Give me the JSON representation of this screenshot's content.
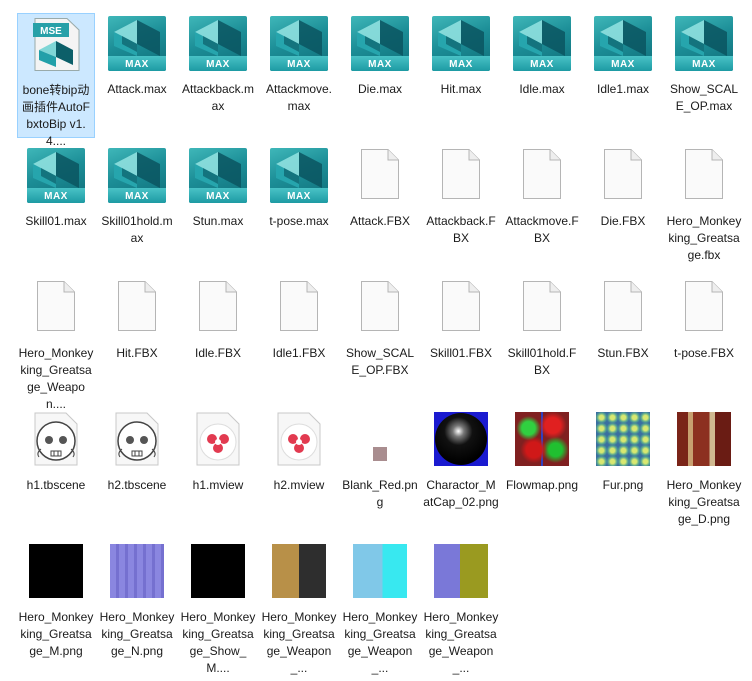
{
  "files": [
    {
      "name": "bone转bip动画插件AutoFbxtoBip v1.4....",
      "icon": "mse-icon",
      "selected": true
    },
    {
      "name": "Attack.max",
      "icon": "max-icon"
    },
    {
      "name": "Attackback.max",
      "icon": "max-icon"
    },
    {
      "name": "Attackmove.max",
      "icon": "max-icon"
    },
    {
      "name": "Die.max",
      "icon": "max-icon"
    },
    {
      "name": "Hit.max",
      "icon": "max-icon"
    },
    {
      "name": "Idle.max",
      "icon": "max-icon"
    },
    {
      "name": "Idle1.max",
      "icon": "max-icon"
    },
    {
      "name": "Show_SCALE_OP.max",
      "icon": "max-icon"
    },
    {
      "name": "Skill01.max",
      "icon": "max-icon"
    },
    {
      "name": "Skill01hold.max",
      "icon": "max-icon"
    },
    {
      "name": "Stun.max",
      "icon": "max-icon"
    },
    {
      "name": "t-pose.max",
      "icon": "max-icon"
    },
    {
      "name": "Attack.FBX",
      "icon": "file-icon"
    },
    {
      "name": "Attackback.FBX",
      "icon": "file-icon"
    },
    {
      "name": "Attackmove.FBX",
      "icon": "file-icon"
    },
    {
      "name": "Die.FBX",
      "icon": "file-icon"
    },
    {
      "name": "Hero_Monkeyking_Greatsage.fbx",
      "icon": "file-icon"
    },
    {
      "name": "Hero_Monkeyking_Greatsage_Weapon....",
      "icon": "file-icon"
    },
    {
      "name": "Hit.FBX",
      "icon": "file-icon"
    },
    {
      "name": "Idle.FBX",
      "icon": "file-icon"
    },
    {
      "name": "Idle1.FBX",
      "icon": "file-icon"
    },
    {
      "name": "Show_SCALE_OP.FBX",
      "icon": "file-icon"
    },
    {
      "name": "Skill01.FBX",
      "icon": "file-icon"
    },
    {
      "name": "Skill01hold.FBX",
      "icon": "file-icon"
    },
    {
      "name": "Stun.FBX",
      "icon": "file-icon"
    },
    {
      "name": "t-pose.FBX",
      "icon": "file-icon"
    },
    {
      "name": "h1.tbscene",
      "icon": "skull-icon"
    },
    {
      "name": "h2.tbscene",
      "icon": "skull-icon"
    },
    {
      "name": "h1.mview",
      "icon": "mview-icon"
    },
    {
      "name": "h2.mview",
      "icon": "mview-icon"
    },
    {
      "name": "Blank_Red.png",
      "icon": "blank-red-thumb"
    },
    {
      "name": "Charactor_MatCap_02.png",
      "icon": "matcap-thumb"
    },
    {
      "name": "Flowmap.png",
      "icon": "flowmap-thumb"
    },
    {
      "name": "Fur.png",
      "icon": "fur-thumb"
    },
    {
      "name": "Hero_Monkeyking_Greatsage_D.png",
      "icon": "diffuse-thumb"
    },
    {
      "name": "Hero_Monkeyking_Greatsage_M.png",
      "icon": "black-thumb"
    },
    {
      "name": "Hero_Monkeyking_Greatsage_N.png",
      "icon": "normal-thumb"
    },
    {
      "name": "Hero_Monkeyking_Greatsage_Show_M....",
      "icon": "black-thumb"
    },
    {
      "name": "Hero_Monkeyking_Greatsage_Weapon_...",
      "icon": "weapon-diffuse-thumb"
    },
    {
      "name": "Hero_Monkeyking_Greatsage_Weapon_...",
      "icon": "cyan-thumb"
    },
    {
      "name": "Hero_Monkeyking_Greatsage_Weapon_...",
      "icon": "weapon-normal-thumb"
    }
  ],
  "labels": {
    "mse": "MSE",
    "max": "MAX"
  },
  "colors": {
    "selection_bg": "#cce8ff",
    "selection_border": "#99d1ff",
    "max_teal": "#1c8e97",
    "mse_teal": "#1e9ea6"
  }
}
